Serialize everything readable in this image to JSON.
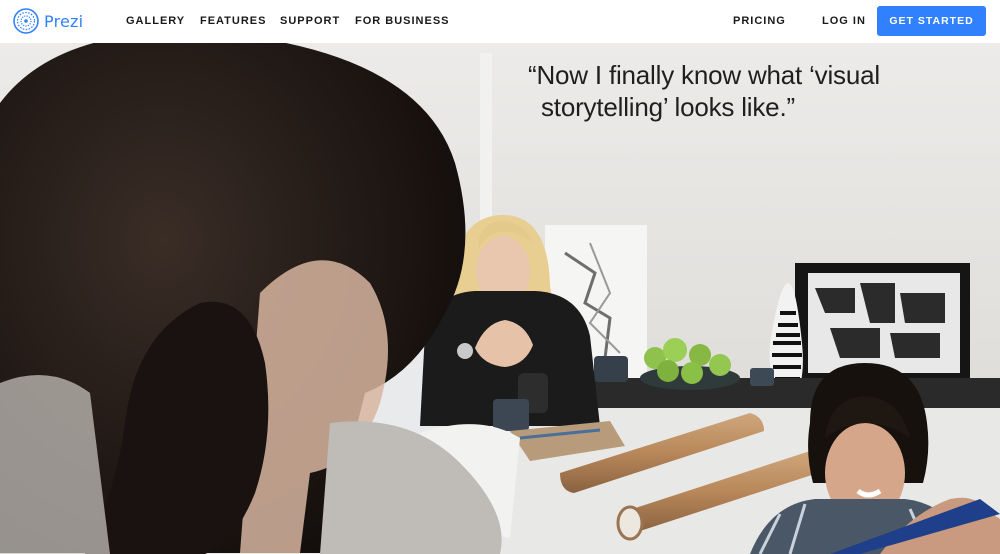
{
  "brand": {
    "name": "Prezi",
    "accent": "#3181ff",
    "logo_icon": "prezi-logo-icon"
  },
  "nav": {
    "left_links": [
      "GALLERY",
      "FEATURES",
      "SUPPORT",
      "FOR BUSINESS"
    ],
    "pricing": "PRICING",
    "login": "LOG IN",
    "cta": "GET STARTED"
  },
  "hero": {
    "quote_line1": "“Now I finally know what ‘visual",
    "quote_line2": "storytelling’ looks like.”"
  }
}
